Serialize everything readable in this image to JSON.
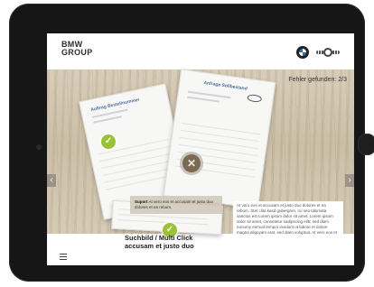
{
  "header": {
    "logo_line1": "BMW",
    "logo_line2": "GROUP",
    "errors_found": "Fehler gefunden: 2/3"
  },
  "documents": {
    "doc1_title": "Auftrag Bestellnummer",
    "doc2_title": "Anfrage Sollbestand"
  },
  "tooltip": {
    "label": "Suport",
    "text": "At vero eos et accusam et justo duo dolores et ea rebum."
  },
  "caption": {
    "line1": "Suchbild / Multi Click",
    "line2": "accusam et justo duo"
  },
  "body_text": "At vero eos et accusam et justo duo dolores et ea rebum. Stet clita kasd gubergren, no sea takimata sanctus est Lorem ipsum dolor sit amet. Lorem ipsum dolor sit amet, consetetur sadipscing elitr, sed diam nonumy eirmod tempor invidunt ut labore et dolore magna aliquyam erat, sed diam voluptua. At vero eos et",
  "icons": {
    "check": "check-icon",
    "close": "close-icon",
    "menu": "menu-icon",
    "arrow_left": "chevron-left-icon",
    "arrow_right": "chevron-right-icon"
  },
  "colors": {
    "check_green": "#9bc137",
    "x_brown": "#7a6a55",
    "wood": "#cbbfa8"
  }
}
